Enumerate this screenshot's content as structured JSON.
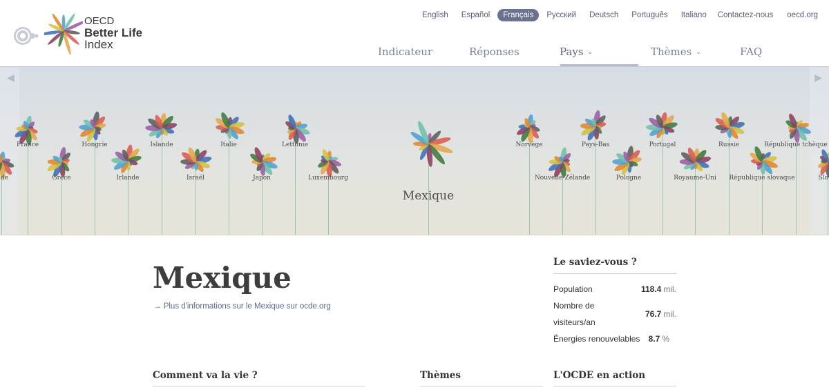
{
  "logo": {
    "line1": "OECD",
    "line2": "Better Life",
    "line3": "Index"
  },
  "languages": [
    {
      "label": "English",
      "active": false
    },
    {
      "label": "Español",
      "active": false
    },
    {
      "label": "Français",
      "active": true
    },
    {
      "label": "Русский",
      "active": false
    },
    {
      "label": "Deutsch",
      "active": false
    },
    {
      "label": "Português",
      "active": false
    },
    {
      "label": "Italiano",
      "active": false
    }
  ],
  "toplinks": {
    "contact": "Contactez-nous",
    "site": "oecd.org"
  },
  "nav": [
    {
      "label": "Indicateur",
      "chevron": false
    },
    {
      "label": "Réponses",
      "chevron": false
    },
    {
      "label": "Pays",
      "chevron": true,
      "active": true
    },
    {
      "label": "Thèmes",
      "chevron": true
    },
    {
      "label": "FAQ",
      "chevron": false
    }
  ],
  "nav_chevron": "⌄",
  "banner": {
    "featured": "Mexique",
    "arrow_left": "◀",
    "arrow_right": "▶",
    "countries": [
      {
        "name": "...de"
      },
      {
        "name": "France"
      },
      {
        "name": "Grèce"
      },
      {
        "name": "Hongrie"
      },
      {
        "name": "Irlande"
      },
      {
        "name": "Islande"
      },
      {
        "name": "Israël"
      },
      {
        "name": "Italie"
      },
      {
        "name": "Japon"
      },
      {
        "name": "Lettonie"
      },
      {
        "name": "Luxembourg"
      },
      {
        "name": "Norvège"
      },
      {
        "name": "Nouvelle-Zélande"
      },
      {
        "name": "Pays-Bas"
      },
      {
        "name": "Pologne"
      },
      {
        "name": "Portugal"
      },
      {
        "name": "Royaume-Uni"
      },
      {
        "name": "Russie"
      },
      {
        "name": "République slovaque"
      },
      {
        "name": "République tchèque"
      },
      {
        "name": "Slov..."
      }
    ]
  },
  "country": {
    "title": "Mexique",
    "more_link": "Plus d'informations sur le Mexique sur ocde.org",
    "more_arrow": "→"
  },
  "facts": {
    "title": "Le saviez-vous ?",
    "items": [
      {
        "label": "Population",
        "value": "118.4",
        "unit": "mil."
      },
      {
        "label": "Nombre de visiteurs/an",
        "value": "76.7",
        "unit": "mil."
      },
      {
        "label": "Énergies renouvelables",
        "value": "8.7",
        "unit": "%"
      }
    ]
  },
  "sections": {
    "life": "Comment va la vie ?",
    "themes": "Thèmes",
    "action": "L'OCDE en action"
  },
  "petal_colors": [
    "#4e9fcf",
    "#6fc0a8",
    "#9b5da3",
    "#5c5c5c",
    "#d95b4f",
    "#e4a64b",
    "#3d7a3f",
    "#8c3f5f",
    "#3d6fb4",
    "#d3c142",
    "#e2862e"
  ]
}
